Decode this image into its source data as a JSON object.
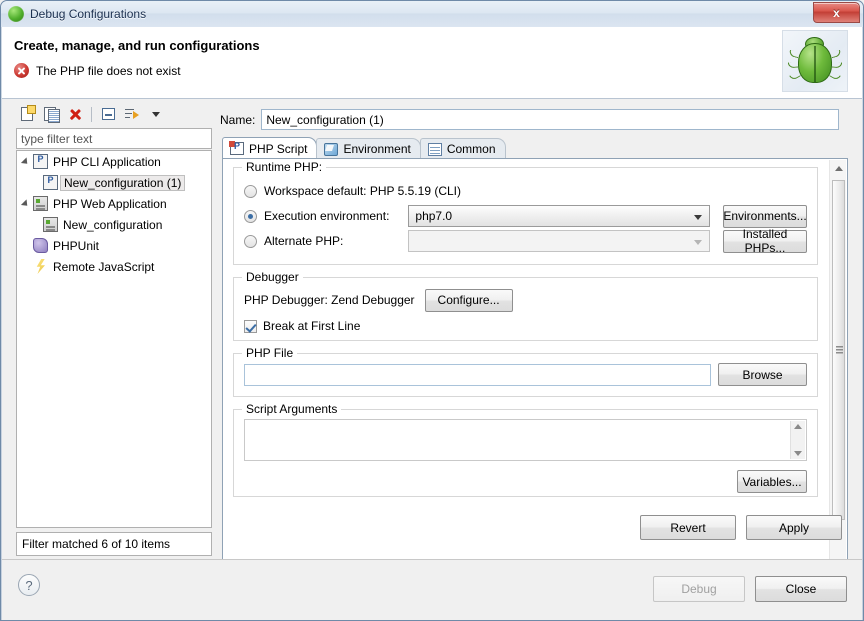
{
  "window": {
    "title": "Debug Configurations",
    "icon": "debug-green-orb-icon",
    "close_label": "x"
  },
  "header": {
    "title": "Create, manage, and run configurations",
    "error_message": "The PHP file does not exist",
    "error_icon": "error-icon",
    "decoration_icon": "green-bug-icon"
  },
  "tree_panel": {
    "toolbar": [
      {
        "name": "new-configuration-button",
        "icon": "new-document-icon"
      },
      {
        "name": "duplicate-configuration-button",
        "icon": "copy-icon"
      },
      {
        "name": "delete-configuration-button",
        "icon": "delete-red-x-icon"
      },
      {
        "name": "collapse-all-button",
        "icon": "collapse-all-icon"
      },
      {
        "name": "filter-button",
        "icon": "filter-icon"
      },
      {
        "name": "view-menu-button",
        "icon": "chevron-down-icon"
      }
    ],
    "filter_placeholder": "type filter text",
    "filter_value": "",
    "items": [
      {
        "label": "PHP CLI Application",
        "level": 0,
        "icon": "php-cli-icon",
        "expanded": true,
        "selected": false
      },
      {
        "label": "New_configuration (1)",
        "level": 1,
        "icon": "php-cli-icon",
        "expanded": false,
        "selected": true
      },
      {
        "label": "PHP Web Application",
        "level": 0,
        "icon": "php-web-icon",
        "expanded": true,
        "selected": false
      },
      {
        "label": "New_configuration",
        "level": 1,
        "icon": "php-web-icon",
        "expanded": false,
        "selected": false
      },
      {
        "label": "PHPUnit",
        "level": 0,
        "icon": "phpunit-icon",
        "expanded": false,
        "selected": false
      },
      {
        "label": "Remote JavaScript",
        "level": 0,
        "icon": "remote-javascript-icon",
        "expanded": false,
        "selected": false
      }
    ],
    "filter_status": "Filter matched 6 of 10 items"
  },
  "config_panel": {
    "name_label": "Name:",
    "name_value": "New_configuration (1)",
    "tabs": [
      {
        "label": "PHP Script",
        "icon": "php-script-icon",
        "active": true
      },
      {
        "label": "Environment",
        "icon": "environment-icon",
        "active": false
      },
      {
        "label": "Common",
        "icon": "common-icon",
        "active": false
      }
    ],
    "runtime_php": {
      "group_title": "Runtime PHP:",
      "workspace_default": {
        "label": "Workspace default: PHP 5.5.19 (CLI)",
        "selected": false
      },
      "execution_environment": {
        "label": "Execution environment:",
        "selected": true,
        "value": "php7.0",
        "button_label": "Environments..."
      },
      "alternate_php": {
        "label": "Alternate PHP:",
        "selected": false,
        "value": "",
        "button_label": "Installed PHPs..."
      }
    },
    "debugger": {
      "group_title": "Debugger",
      "debugger_label": "PHP Debugger: Zend Debugger",
      "configure_label": "Configure...",
      "break_first_line_label": "Break at First Line",
      "break_first_line_checked": true
    },
    "php_file": {
      "group_title": "PHP File",
      "value": "",
      "browse_label": "Browse"
    },
    "script_arguments": {
      "group_title": "Script Arguments",
      "value": "",
      "variables_label": "Variables..."
    },
    "revert_label": "Revert",
    "apply_label": "Apply"
  },
  "footer": {
    "help_icon": "help-question-icon",
    "debug_label": "Debug",
    "debug_enabled": false,
    "close_label": "Close",
    "close_enabled": true
  },
  "colors": {
    "accent": "#3c6ea5",
    "error": "#cc3a33",
    "titlebar": "#dde7f2",
    "dialog_bg": "#f0f0f0"
  }
}
